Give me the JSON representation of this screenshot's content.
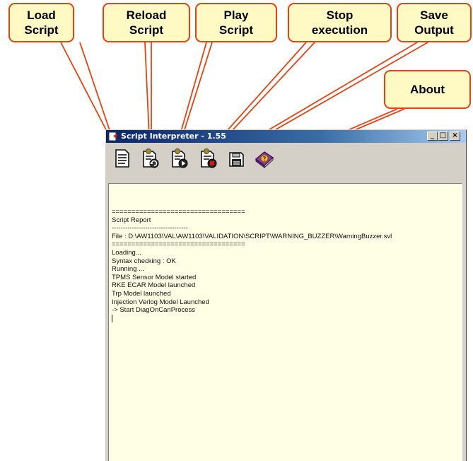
{
  "callouts": {
    "load": {
      "line1": "Load",
      "line2": "Script"
    },
    "reload": {
      "line1": "Reload",
      "line2": "Script"
    },
    "play": {
      "line1": "Play",
      "line2": "Script"
    },
    "stop": {
      "line1": "Stop",
      "line2": "execution"
    },
    "save": {
      "line1": "Save",
      "line2": "Output"
    },
    "about": {
      "line1": "About"
    }
  },
  "window": {
    "title": "Script Interpreter - 1.55",
    "minimize": "_",
    "maximize": "□",
    "close": "×"
  },
  "toolbar": {
    "buttons": [
      {
        "name": "load-script",
        "icon": "document-icon"
      },
      {
        "name": "reload-script",
        "icon": "document-reload-icon"
      },
      {
        "name": "play-script",
        "icon": "document-play-icon"
      },
      {
        "name": "stop-execution",
        "icon": "document-stop-icon"
      },
      {
        "name": "save-output",
        "icon": "floppy-save-icon"
      },
      {
        "name": "about",
        "icon": "help-book-icon"
      }
    ]
  },
  "output": {
    "lines": [
      "==================================",
      "Script Report",
      "----------------------------------",
      "File : D:\\AW1103\\VAL\\AW1103\\VALIDATION\\SCRIPT\\WARNING_BUZZER\\WarningBuzzer.svl",
      "==================================",
      "Loading...",
      "Syntax checking : OK",
      "Running ...",
      "TPMS Sensor Model started",
      "RKE ECAR Model launched",
      "Trp Model launched",
      "Injection Verlog Model Launched",
      "-> Start DiagOnCanProcess"
    ]
  },
  "colors": {
    "callout_fill": "#fff9c4",
    "callout_border": "#e8420f",
    "titlebar_start": "#0a246a",
    "titlebar_end": "#a6caf0",
    "output_bg": "#ffffe6"
  }
}
